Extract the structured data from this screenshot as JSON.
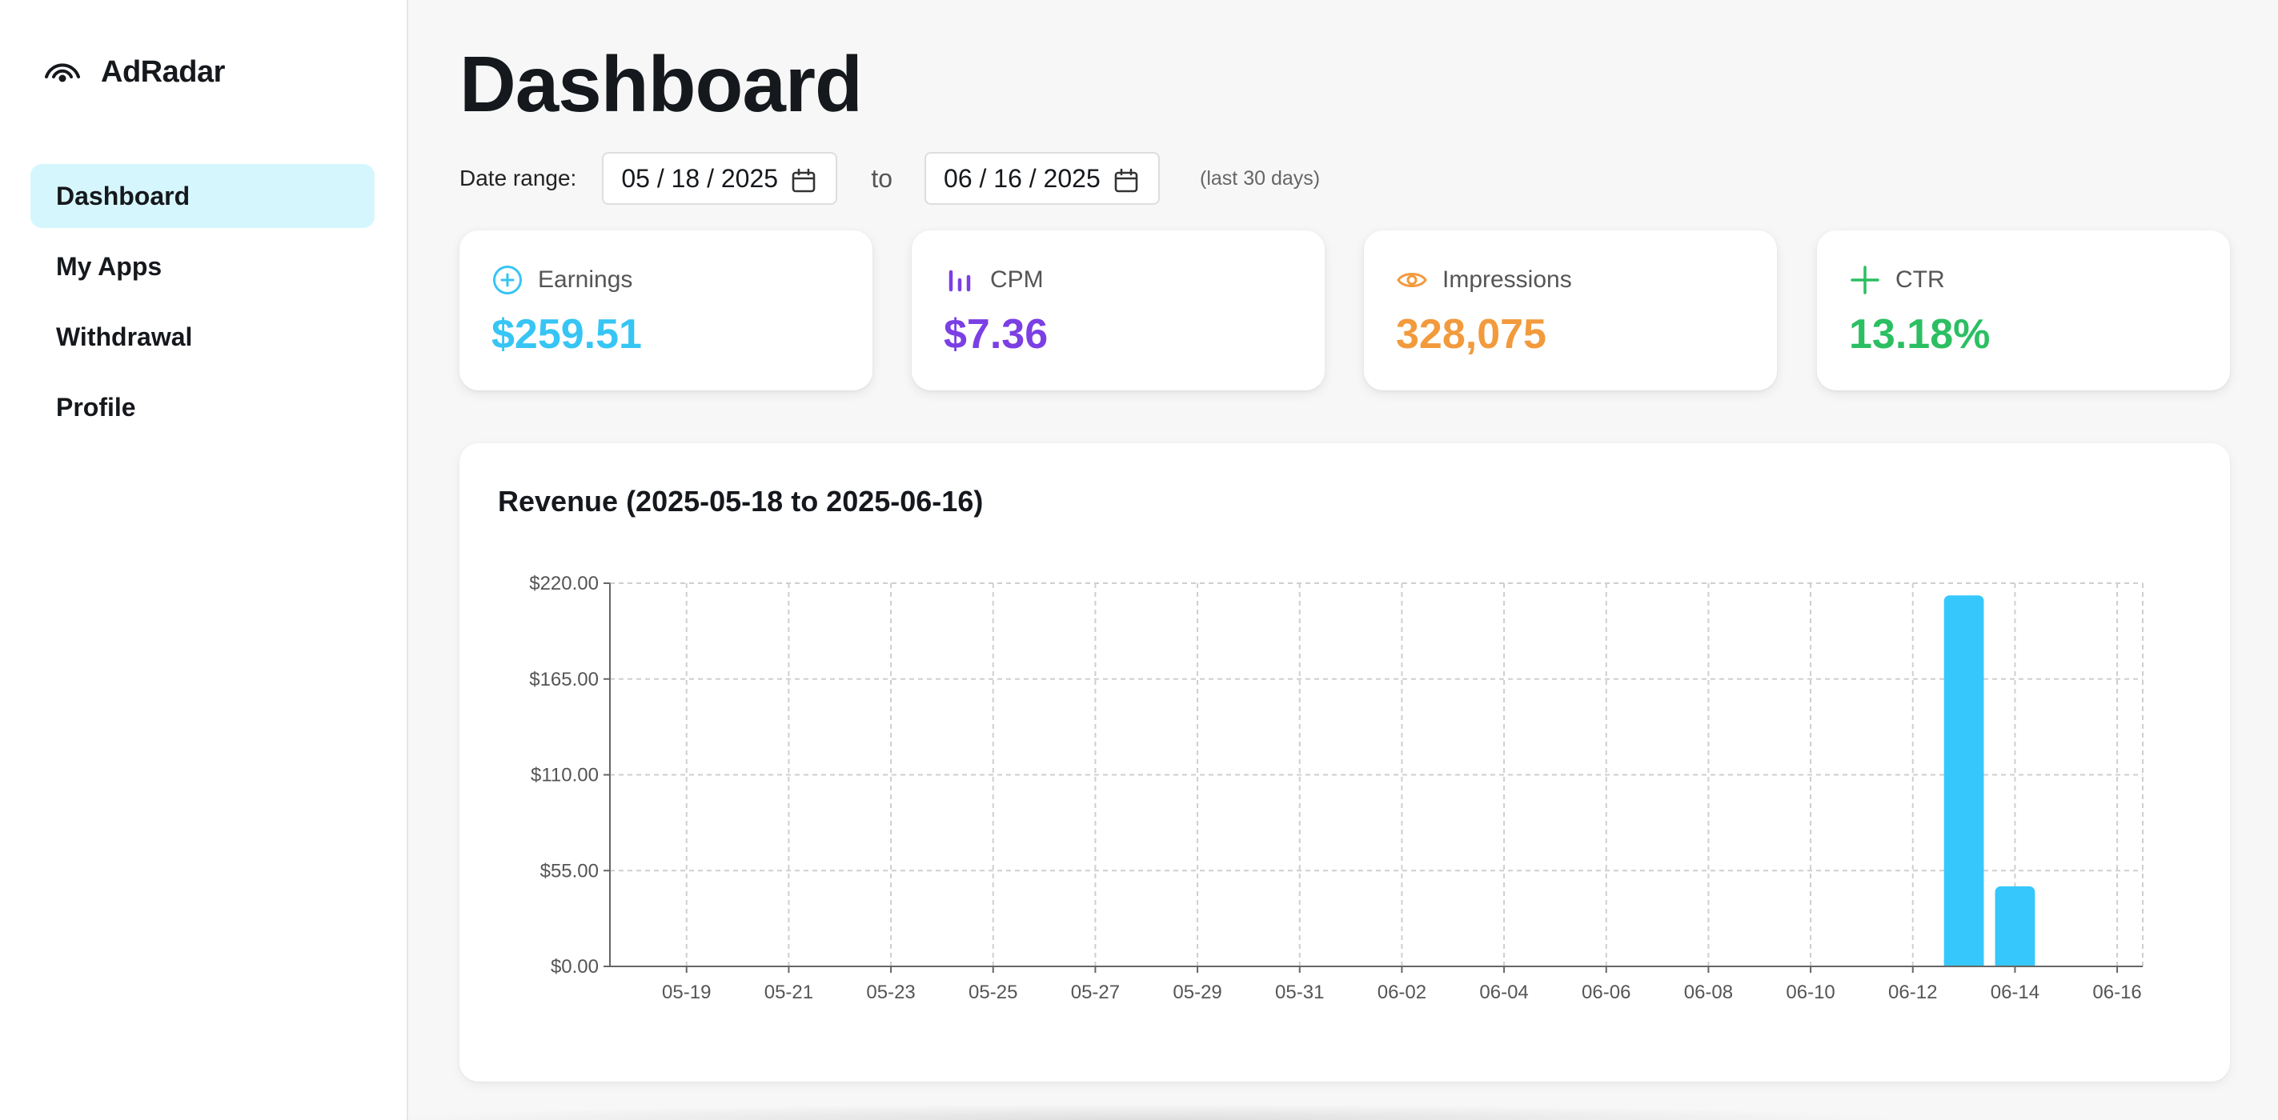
{
  "brand": {
    "name": "AdRadar",
    "icon": "signal-wave-icon"
  },
  "nav": {
    "items": [
      {
        "label": "Dashboard",
        "active": true
      },
      {
        "label": "My Apps",
        "active": false
      },
      {
        "label": "Withdrawal",
        "active": false
      },
      {
        "label": "Profile",
        "active": false
      }
    ]
  },
  "page": {
    "title": "Dashboard"
  },
  "date_range": {
    "label": "Date range:",
    "from": "05 / 18 / 2025",
    "to_label": "to",
    "to": "06 / 16 / 2025",
    "hint": "(last 30 days)"
  },
  "cards": [
    {
      "label": "Earnings",
      "value": "$259.51",
      "color": "#36c5f4",
      "icon": "plus-circle-icon"
    },
    {
      "label": "CPM",
      "value": "$7.36",
      "color": "#7b3fe4",
      "icon": "bar-chart-icon"
    },
    {
      "label": "Impressions",
      "value": "328,075",
      "color": "#f29a3c",
      "icon": "eye-icon"
    },
    {
      "label": "CTR",
      "value": "13.18%",
      "color": "#2bbf62",
      "icon": "plus-icon"
    }
  ],
  "chart_data": {
    "type": "bar",
    "title": "Revenue (2025-05-18 to 2025-06-16)",
    "xlabel": "",
    "ylabel": "",
    "ylim": [
      0,
      220
    ],
    "yticks": [
      "$0.00",
      "$55.00",
      "$110.00",
      "$165.00",
      "$220.00"
    ],
    "ytick_values": [
      0,
      55,
      110,
      165,
      220
    ],
    "xticks": [
      "05-19",
      "05-21",
      "05-23",
      "05-25",
      "05-27",
      "05-29",
      "05-31",
      "06-02",
      "06-04",
      "06-06",
      "06-08",
      "06-10",
      "06-12",
      "06-14",
      "06-16"
    ],
    "categories": [
      "05-18",
      "05-19",
      "05-20",
      "05-21",
      "05-22",
      "05-23",
      "05-24",
      "05-25",
      "05-26",
      "05-27",
      "05-28",
      "05-29",
      "05-30",
      "05-31",
      "06-01",
      "06-02",
      "06-03",
      "06-04",
      "06-05",
      "06-06",
      "06-07",
      "06-08",
      "06-09",
      "06-10",
      "06-11",
      "06-12",
      "06-13",
      "06-14",
      "06-15",
      "06-16"
    ],
    "values": [
      0,
      0,
      0,
      0,
      0,
      0,
      0,
      0,
      0,
      0,
      0,
      0,
      0,
      0,
      0,
      0,
      0,
      0,
      0,
      0,
      0,
      0,
      0,
      0,
      0,
      0,
      213,
      46,
      0,
      0
    ],
    "grid": true,
    "bar_color": "#36c8fc"
  }
}
